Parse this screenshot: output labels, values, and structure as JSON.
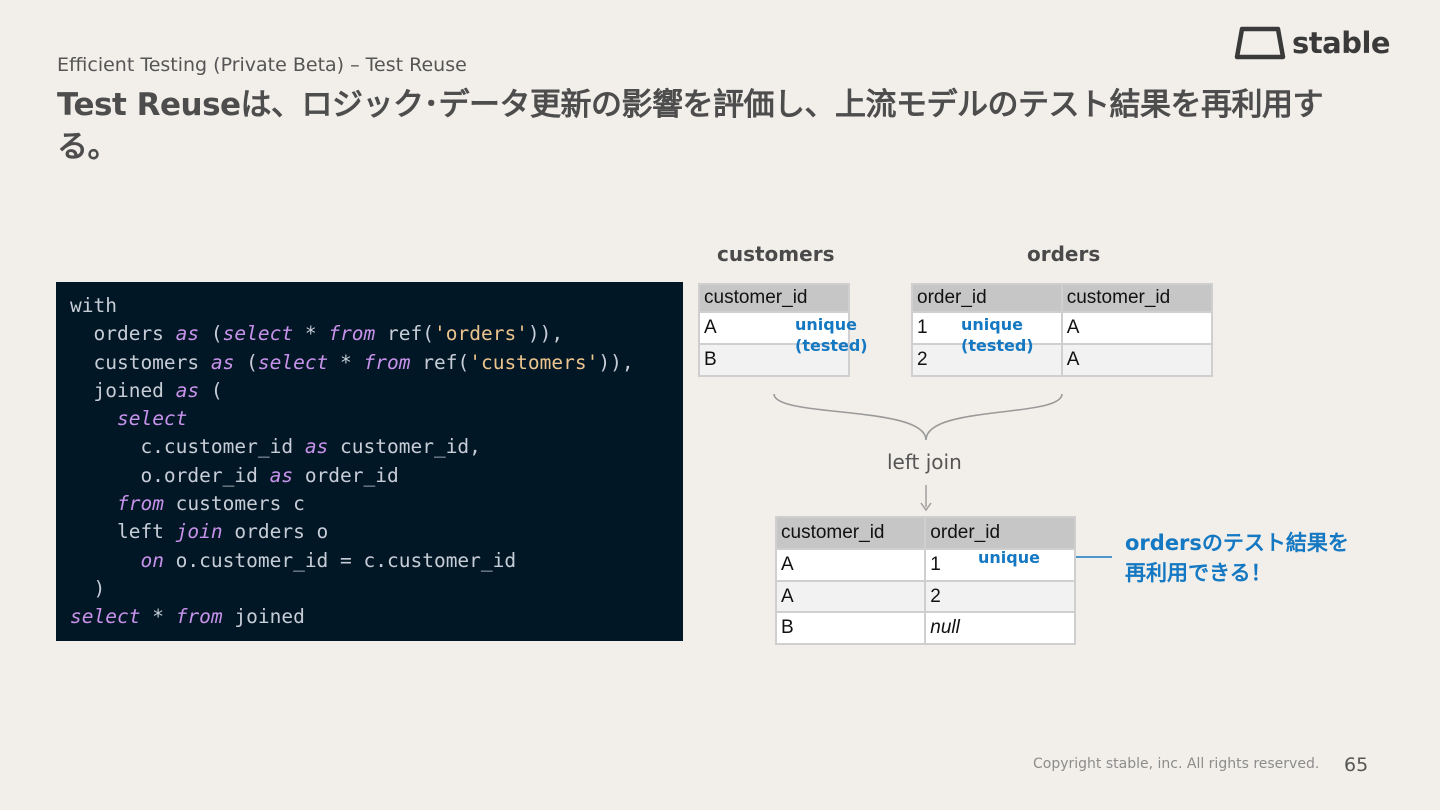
{
  "header": {
    "subtitle": "Efficient Testing (Private Beta) – Test Reuse",
    "title": "Test Reuseは、ロジック･データ更新の影響を評価し、上流モデルのテスト結果を再利用する。"
  },
  "logo": {
    "text": "stable"
  },
  "code": {
    "lines": [
      [
        {
          "t": "with",
          "c": "plain"
        }
      ],
      [
        {
          "t": "  orders ",
          "c": "plain"
        },
        {
          "t": "as",
          "c": "kw"
        },
        {
          "t": " (",
          "c": "plain"
        },
        {
          "t": "select",
          "c": "kw"
        },
        {
          "t": " * ",
          "c": "plain"
        },
        {
          "t": "from",
          "c": "kw"
        },
        {
          "t": " ref(",
          "c": "plain"
        },
        {
          "t": "'orders'",
          "c": "str"
        },
        {
          "t": ")),",
          "c": "plain"
        }
      ],
      [
        {
          "t": "  customers ",
          "c": "plain"
        },
        {
          "t": "as",
          "c": "kw"
        },
        {
          "t": " (",
          "c": "plain"
        },
        {
          "t": "select",
          "c": "kw"
        },
        {
          "t": " * ",
          "c": "plain"
        },
        {
          "t": "from",
          "c": "kw"
        },
        {
          "t": " ref(",
          "c": "plain"
        },
        {
          "t": "'customers'",
          "c": "str"
        },
        {
          "t": ")),",
          "c": "plain"
        }
      ],
      [
        {
          "t": "  joined ",
          "c": "plain"
        },
        {
          "t": "as",
          "c": "kw"
        },
        {
          "t": " (",
          "c": "plain"
        }
      ],
      [
        {
          "t": "    ",
          "c": "plain"
        },
        {
          "t": "select",
          "c": "kw"
        }
      ],
      [
        {
          "t": "      c.customer_id ",
          "c": "plain"
        },
        {
          "t": "as",
          "c": "kw"
        },
        {
          "t": " customer_id,",
          "c": "plain"
        }
      ],
      [
        {
          "t": "      o.order_id ",
          "c": "plain"
        },
        {
          "t": "as",
          "c": "kw"
        },
        {
          "t": " order_id",
          "c": "plain"
        }
      ],
      [
        {
          "t": "    ",
          "c": "plain"
        },
        {
          "t": "from",
          "c": "kw"
        },
        {
          "t": " customers c",
          "c": "plain"
        }
      ],
      [
        {
          "t": "    left ",
          "c": "plain"
        },
        {
          "t": "join",
          "c": "kw"
        },
        {
          "t": " orders o",
          "c": "plain"
        }
      ],
      [
        {
          "t": "      ",
          "c": "plain"
        },
        {
          "t": "on",
          "c": "kw"
        },
        {
          "t": " o.customer_id = c.customer_id",
          "c": "plain"
        }
      ],
      [
        {
          "t": "  )",
          "c": "plain"
        }
      ],
      [
        {
          "t": "select",
          "c": "kw"
        },
        {
          "t": " * ",
          "c": "plain"
        },
        {
          "t": "from",
          "c": "kw"
        },
        {
          "t": " joined",
          "c": "plain"
        }
      ]
    ]
  },
  "customers_table": {
    "title": "customers",
    "header": [
      "customer_id"
    ],
    "rows": [
      [
        "A"
      ],
      [
        "B"
      ]
    ],
    "tag": "unique\n(tested)"
  },
  "orders_table": {
    "title": "orders",
    "header": [
      "order_id",
      "customer_id"
    ],
    "rows": [
      [
        "1",
        "A"
      ],
      [
        "2",
        "A"
      ]
    ],
    "tag": "unique\n(tested)"
  },
  "join": {
    "label": "left join"
  },
  "joined_table": {
    "header": [
      "customer_id",
      "order_id"
    ],
    "rows": [
      [
        "A",
        "1"
      ],
      [
        "A",
        "2"
      ],
      [
        "B",
        "null"
      ]
    ],
    "tag": "unique"
  },
  "callout": {
    "text": "ordersのテスト結果を\n再利用できる！"
  },
  "footer": {
    "copyright": "Copyright stable, inc. All rights reserved.",
    "page_number": "65"
  },
  "colors": {
    "accent_blue": "#1578c2",
    "code_bg": "#021726",
    "code_keyword": "#c792ea",
    "code_string": "#ecc48d"
  }
}
